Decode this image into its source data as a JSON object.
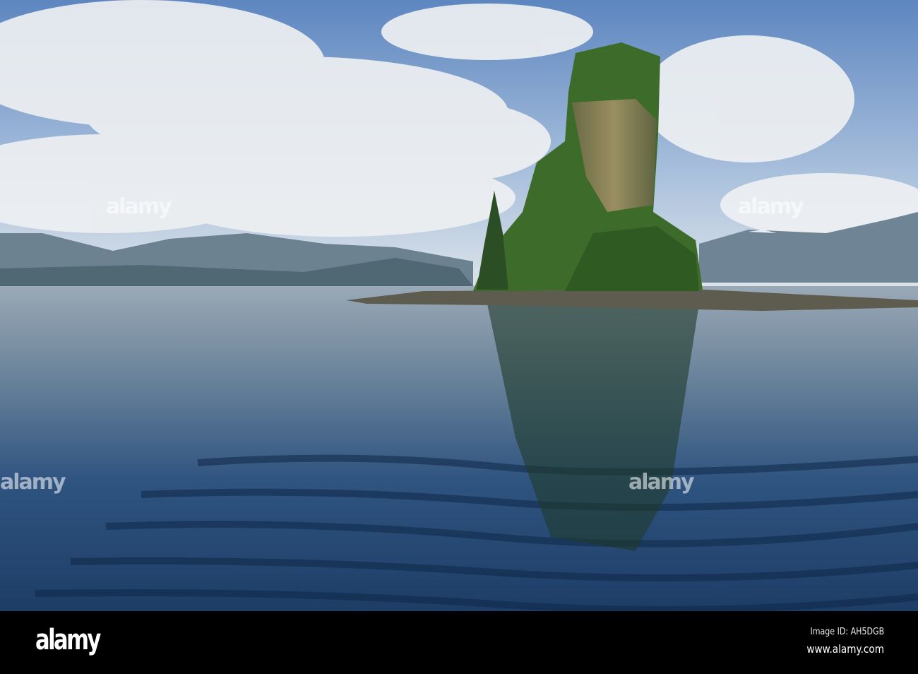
{
  "footer": {
    "logo": "alamy",
    "image_id": "Image ID: AH5DGB",
    "url": "www.alamy.com"
  },
  "watermark": "alamy",
  "colors": {
    "sky": "#7fa3cf",
    "water_dark": "#16355e",
    "foliage": "#3f6f2a"
  }
}
